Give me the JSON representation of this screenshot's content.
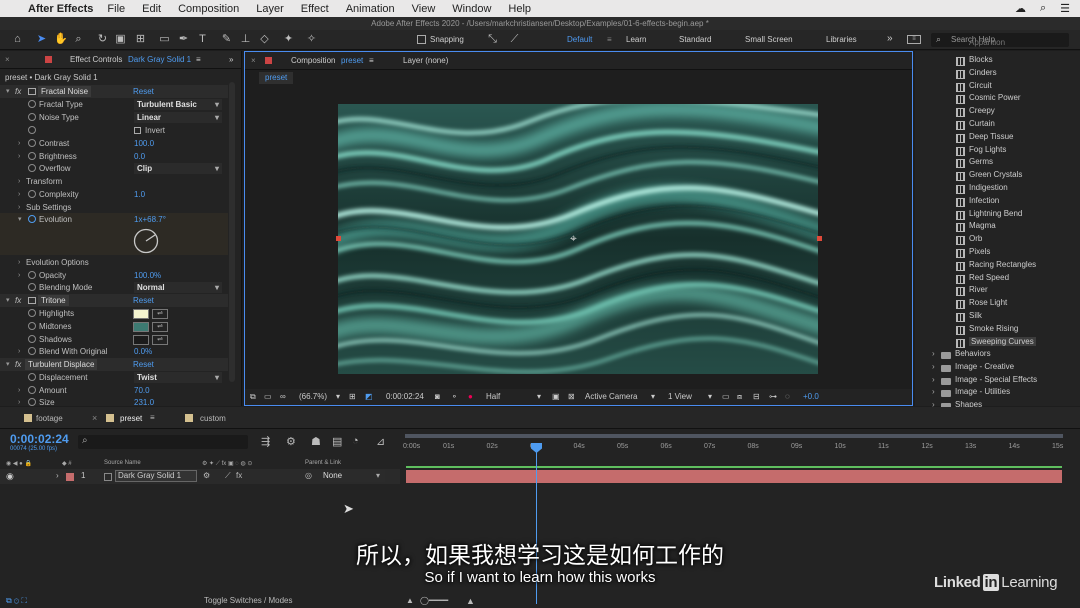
{
  "menubar": {
    "app": "After Effects",
    "items": [
      "File",
      "Edit",
      "Composition",
      "Layer",
      "Effect",
      "Animation",
      "View",
      "Window",
      "Help"
    ]
  },
  "window_title": "Adobe After Effects 2020 - /Users/markchristiansen/Desktop/Examples/01-6-effects-begin.aep *",
  "toolbar": {
    "snapping": "Snapping",
    "workspaces": [
      "Default",
      "Learn",
      "Standard",
      "Small Screen",
      "Libraries"
    ],
    "active_workspace": "Default",
    "search_placeholder": "Search Help"
  },
  "effect_controls": {
    "tab": "Effect Controls",
    "tab_layer": "Dark Gray Solid 1",
    "breadcrumb": "preset • Dark Gray Solid 1",
    "reset": "Reset",
    "fractal_noise": "Fractal Noise",
    "rows": {
      "fractal_type": {
        "label": "Fractal Type",
        "value": "Turbulent Basic"
      },
      "noise_type": {
        "label": "Noise Type",
        "value": "Linear"
      },
      "invert": {
        "label": "Invert"
      },
      "contrast": {
        "label": "Contrast",
        "value": "100.0"
      },
      "brightness": {
        "label": "Brightness",
        "value": "0.0"
      },
      "overflow": {
        "label": "Overflow",
        "value": "Clip"
      },
      "transform": {
        "label": "Transform"
      },
      "complexity": {
        "label": "Complexity",
        "value": "1.0"
      },
      "sub_settings": {
        "label": "Sub Settings"
      },
      "evolution": {
        "label": "Evolution",
        "value": "1x+68.7°"
      },
      "evolution_options": {
        "label": "Evolution Options"
      },
      "opacity": {
        "label": "Opacity",
        "value": "100.0%"
      },
      "blending_mode": {
        "label": "Blending Mode",
        "value": "Normal"
      }
    },
    "tritone": "Tritone",
    "tritone_rows": {
      "highlights": "Highlights",
      "midtones": "Midtones",
      "shadows": "Shadows",
      "blend": {
        "label": "Blend With Original",
        "value": "0.0%"
      }
    },
    "turbulent_displace": "Turbulent Displace",
    "td_rows": {
      "displacement": {
        "label": "Displacement",
        "value": "Twist"
      },
      "amount": {
        "label": "Amount",
        "value": "70.0"
      },
      "size": {
        "label": "Size",
        "value": "231.0"
      }
    },
    "colors": {
      "highlights": "#f3f3cf",
      "midtones": "#3d7a72",
      "shadows": "#1b1b1b"
    }
  },
  "composition": {
    "tab": "Composition",
    "tab_name": "preset",
    "layer_tab": "Layer (none)",
    "subtab": "preset",
    "bottom": {
      "zoom": "(66.7%)",
      "time": "0:00:02:24",
      "resolution": "Half",
      "camera": "Active Camera",
      "views": "1 View",
      "exposure": "+0.0"
    }
  },
  "effects_list": {
    "items": [
      "Blocks",
      "Cinders",
      "Circuit",
      "Cosmic Power",
      "Creepy",
      "Curtain",
      "Deep Tissue",
      "Fog Lights",
      "Germs",
      "Green Crystals",
      "Indigestion",
      "Infection",
      "Lightning Bend",
      "Magma",
      "Orb",
      "Pixels",
      "Racing Rectangles",
      "Red Speed",
      "River",
      "Rose Light",
      "Silk",
      "Smoke Rising",
      "Sweeping Curves"
    ],
    "selected": "Sweeping Curves",
    "top_partial": "Apparition",
    "folders": [
      "Behaviors",
      "Image - Creative",
      "Image - Special Effects",
      "Image - Utilities",
      "Shapes"
    ]
  },
  "timeline": {
    "tabs": [
      "footage",
      "preset",
      "custom"
    ],
    "active_tab": "preset",
    "timecode": "0:00:02:24",
    "fps": "00074 (25.00 fps)",
    "columns": {
      "source": "Source Name",
      "parent": "Parent & Link"
    },
    "layer": {
      "num": "1",
      "name": "Dark Gray Solid 1",
      "parent": "None",
      "color": "#c56c6c"
    },
    "ruler": [
      "0:00s",
      "01s",
      "02s",
      "03s",
      "04s",
      "05s",
      "06s",
      "07s",
      "08s",
      "09s",
      "10s",
      "11s",
      "12s",
      "13s",
      "14s",
      "15s"
    ],
    "toggle": "Toggle Switches / Modes"
  },
  "subtitle": {
    "chinese": "所以，如果我想学习这是如何工作的",
    "english": "So if I want to learn how this works"
  },
  "branding": {
    "linked": "Linked",
    "in": "in",
    "learning": "Learning"
  }
}
